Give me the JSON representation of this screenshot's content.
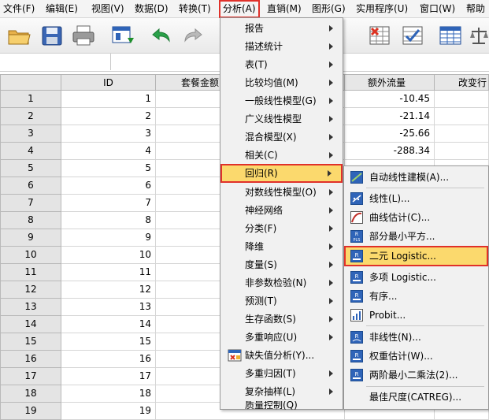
{
  "menubar": {
    "items": [
      "文件(F)",
      "编辑(E)",
      "视图(V)",
      "数据(D)",
      "转换(T)",
      "分析(A)",
      "直销(M)",
      "图形(G)",
      "实用程序(U)",
      "窗口(W)",
      "帮助"
    ]
  },
  "grid": {
    "columns": [
      "ID",
      "套餐金额",
      "额外流量",
      "改变行"
    ],
    "rows": [
      {
        "n": "1",
        "id": "1",
        "extra": "-10.45"
      },
      {
        "n": "2",
        "id": "2",
        "extra": "-21.14"
      },
      {
        "n": "3",
        "id": "3",
        "extra": "-25.66"
      },
      {
        "n": "4",
        "id": "4",
        "extra": "-288.34"
      },
      {
        "n": "5",
        "id": "5",
        "extra": ""
      },
      {
        "n": "6",
        "id": "6",
        "extra": ""
      },
      {
        "n": "7",
        "id": "7",
        "extra": ""
      },
      {
        "n": "8",
        "id": "8",
        "extra": ""
      },
      {
        "n": "9",
        "id": "9",
        "extra": ""
      },
      {
        "n": "10",
        "id": "10",
        "extra": ""
      },
      {
        "n": "11",
        "id": "11",
        "extra": ""
      },
      {
        "n": "12",
        "id": "12",
        "extra": ""
      },
      {
        "n": "13",
        "id": "13",
        "extra": ""
      },
      {
        "n": "14",
        "id": "14",
        "extra": ""
      },
      {
        "n": "15",
        "id": "15",
        "extra": ""
      },
      {
        "n": "16",
        "id": "16",
        "extra": ""
      },
      {
        "n": "17",
        "id": "17",
        "extra": ""
      },
      {
        "n": "18",
        "id": "18",
        "extra": ""
      },
      {
        "n": "19",
        "id": "19",
        "extra": ""
      }
    ]
  },
  "analyze_menu": {
    "items": [
      "报告",
      "描述统计",
      "表(T)",
      "比较均值(M)",
      "一般线性模型(G)",
      "广义线性模型",
      "混合模型(X)",
      "相关(C)",
      "回归(R)",
      "对数线性模型(O)",
      "神经网络",
      "分类(F)",
      "降维",
      "度量(S)",
      "非参数检验(N)",
      "预测(T)",
      "生存函数(S)",
      "多重响应(U)",
      "缺失值分析(Y)...",
      "多重归因(T)",
      "复杂抽样(L)",
      "质量控制(Q)"
    ]
  },
  "regression_menu": {
    "items": [
      "自动线性建模(A)...",
      "线性(L)...",
      "曲线估计(C)...",
      "部分最小平方...",
      "二元 Logistic...",
      "多项 Logistic...",
      "有序...",
      "Probit...",
      "非线性(N)...",
      "权重估计(W)...",
      "两阶最小二乘法(2)...",
      "最佳尺度(CATREG)..."
    ]
  },
  "colors": {
    "highlight": "#fbd96d",
    "highlight_border": "#e0312a",
    "menu_bg": "#f1f1f1"
  }
}
